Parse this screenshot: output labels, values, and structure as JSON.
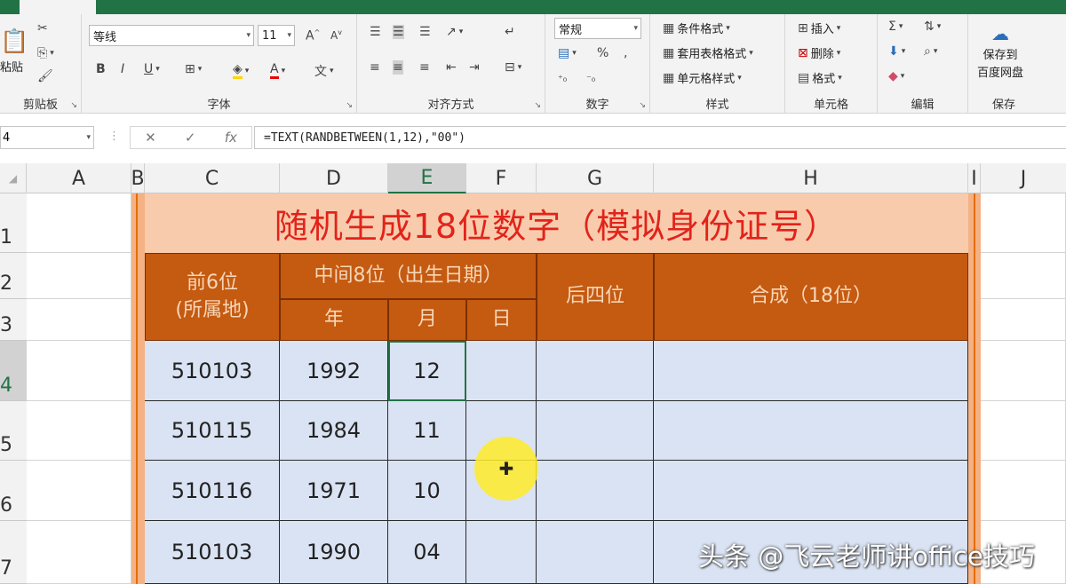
{
  "ribbon": {
    "clipboard": {
      "paste_label": "粘贴",
      "group": "剪贴板"
    },
    "font": {
      "font_name": "等线",
      "font_size": "11",
      "group": "字体"
    },
    "alignment": {
      "group": "对齐方式"
    },
    "number": {
      "format": "常规",
      "group": "数字"
    },
    "styles": {
      "conditional": "条件格式",
      "table_format": "套用表格格式",
      "cell_styles": "单元格样式",
      "group": "样式"
    },
    "cells": {
      "insert": "插入",
      "delete": "删除",
      "format": "格式",
      "group": "单元格"
    },
    "editing": {
      "group": "编辑"
    },
    "save": {
      "line1": "保存到",
      "line2": "百度网盘",
      "group": "保存"
    }
  },
  "formula_bar": {
    "name_box": "4",
    "formula": "=TEXT(RANDBETWEEN(1,12),\"00\")"
  },
  "columns": [
    "A",
    "B",
    "C",
    "D",
    "E",
    "F",
    "G",
    "H",
    "I",
    "J"
  ],
  "rows": [
    "1",
    "2",
    "3",
    "4",
    "5",
    "6",
    "7"
  ],
  "table": {
    "title": "随机生成18位数字（模拟身份证号）",
    "headers": {
      "first6": "前6位\n(所属地)",
      "middle8": "中间8位（出生日期）",
      "year": "年",
      "month": "月",
      "day": "日",
      "last4": "后四位",
      "combined": "合成（18位）"
    },
    "data": [
      {
        "first6": "510103",
        "year": "1992",
        "month": "12",
        "day": "",
        "last4": "",
        "combined": ""
      },
      {
        "first6": "510115",
        "year": "1984",
        "month": "11",
        "day": "",
        "last4": "",
        "combined": ""
      },
      {
        "first6": "510116",
        "year": "1971",
        "month": "10",
        "day": "",
        "last4": "",
        "combined": ""
      },
      {
        "first6": "510103",
        "year": "1990",
        "month": "04",
        "day": "",
        "last4": "",
        "combined": ""
      }
    ]
  },
  "watermark": "头条 @飞云老师讲office技巧",
  "colors": {
    "excel_green": "#217346",
    "title_fill": "#f8cbad",
    "title_text": "#e2231a",
    "header_fill": "#c55a11",
    "data_fill": "#dae3f3"
  }
}
